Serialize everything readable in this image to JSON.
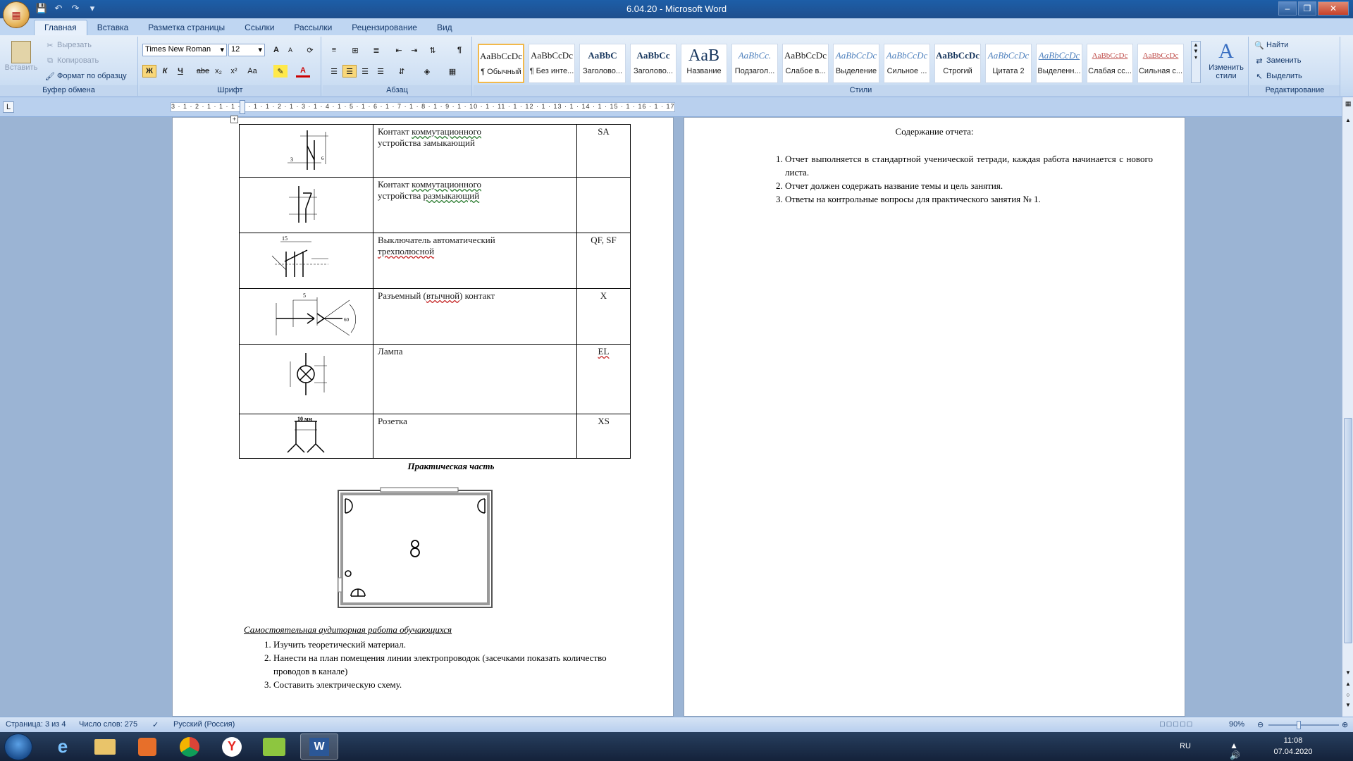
{
  "window": {
    "title": "6.04.20 - Microsoft Word",
    "qat": [
      "save-icon",
      "undo-icon",
      "redo-icon",
      "customize-icon"
    ]
  },
  "tabs": [
    "Главная",
    "Вставка",
    "Разметка страницы",
    "Ссылки",
    "Рассылки",
    "Рецензирование",
    "Вид"
  ],
  "ribbon": {
    "clipboard": {
      "paste": "Вставить",
      "cut": "Вырезать",
      "copy": "Копировать",
      "format_painter": "Формат по образцу",
      "label": "Буфер обмена"
    },
    "font": {
      "name": "Times New Roman",
      "size": "12",
      "label": "Шрифт",
      "bold": "Ж",
      "italic": "К",
      "underline": "Ч",
      "strike": "abe",
      "sub": "x₂",
      "sup": "x²",
      "case": "Aa",
      "grow": "A",
      "shrink": "A"
    },
    "paragraph": {
      "label": "Абзац"
    },
    "styles": {
      "label": "Стили",
      "change_styles": "Изменить стили",
      "items": [
        {
          "sample": "AaBbCcDc",
          "name": "¶ Обычный"
        },
        {
          "sample": "AaBbCcDc",
          "name": "¶ Без инте..."
        },
        {
          "sample": "AaBbC",
          "name": "Заголово..."
        },
        {
          "sample": "AaBbCc",
          "name": "Заголово..."
        },
        {
          "sample": "AaB",
          "name": "Название"
        },
        {
          "sample": "AaBbCc.",
          "name": "Подзагол..."
        },
        {
          "sample": "AaBbCcDc",
          "name": "Слабое в..."
        },
        {
          "sample": "AaBbCcDc",
          "name": "Выделение"
        },
        {
          "sample": "AaBbCcDc",
          "name": "Сильное ..."
        },
        {
          "sample": "AaBbCcDc",
          "name": "Строгий"
        },
        {
          "sample": "AaBbCcDc",
          "name": "Цитата 2"
        },
        {
          "sample": "AaBbCcDc",
          "name": "Выделенн..."
        },
        {
          "sample": "AaBbCcDc",
          "name": "Слабая сс..."
        },
        {
          "sample": "AaBbCcDc",
          "name": "Сильная с..."
        }
      ]
    },
    "editing": {
      "label": "Редактирование",
      "find": "Найти",
      "replace": "Заменить",
      "select": "Выделить"
    }
  },
  "ruler": {
    "text": "3 · 1 · 2 · 1 · 1 · 1 · · · 1 · 1 · 2 · 1 · 3 · 1 · 4 · 1 · 5 · 1 · 6 · 1 · 7 · 1 · 8 · 1 · 9 · 1 · 10 · 1 · 11 · 1 · 12 · 1 · 13 · 1 · 14 · 1 · 15 · 1 · 16 · 1 · 17 · 1"
  },
  "left_page": {
    "table": [
      {
        "desc": [
          "Контакт ",
          "коммутационного",
          " устройства замыкающий"
        ],
        "code": "SA"
      },
      {
        "desc": [
          "Контакт ",
          "коммутационного",
          " устройства ",
          "размыкающий"
        ],
        "code": ""
      },
      {
        "desc": [
          "Выключатель  автоматический ",
          "трехполюсной"
        ],
        "code": "QF, SF"
      },
      {
        "desc": [
          "Разъемный (",
          "втычной",
          ") контакт"
        ],
        "code": "X"
      },
      {
        "desc": [
          "Лампа"
        ],
        "code": "EL"
      },
      {
        "desc": [
          "Розетка"
        ],
        "code": "XS"
      }
    ],
    "socket_label": "10 мм",
    "practical_title": "Практическая  часть",
    "independent_title": "Самостоятельная  аудиторная работа обучающихся",
    "tasks": [
      "Изучить теоретический  материал.",
      "Нанести на план помещения линии электропроводок (засечками показать количество проводов в канале)",
      "Составить электрическую  схему."
    ]
  },
  "right_page": {
    "heading": "Содержание отчета:",
    "items": [
      "Отчет  выполняется  в  стандартной  ученической  тетради,  каждая  работа  начинается с нового листа.",
      "Отчет должен содержать  название темы и цель занятия.",
      "Ответы на контрольные вопросы для практического занятия № 1."
    ]
  },
  "statusbar": {
    "page": "Страница: 3 из 4",
    "words": "Число слов: 275",
    "lang": "Русский (Россия)",
    "zoom": "90%"
  },
  "taskbar": {
    "lang": "RU",
    "time": "11:08",
    "date": "07.04.2020",
    "word_label": "W"
  }
}
